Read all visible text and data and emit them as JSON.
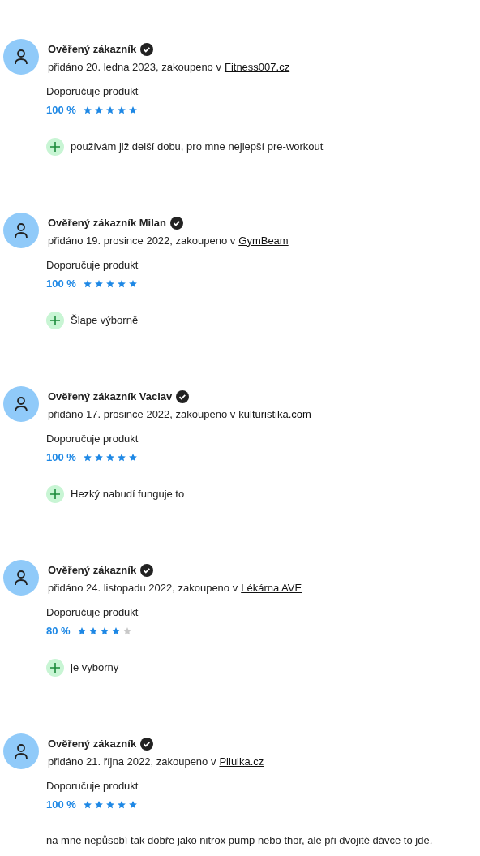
{
  "reviews": [
    {
      "author": "Ověřený zákazník",
      "verified": true,
      "date": "přidáno 20. ledna 2023, zakoupeno v",
      "shop": "Fitness007.cz",
      "recommend": "Doporučuje produkt",
      "percent": "100 %",
      "stars": 5,
      "comments": [
        {
          "kind": "pro",
          "text": "používám již delší dobu, pro mne nejlepší pre-workout"
        }
      ]
    },
    {
      "author": "Ověřený zákazník Milan",
      "verified": true,
      "date": "přidáno 19. prosince 2022, zakoupeno v",
      "shop": "GymBeam",
      "recommend": "Doporučuje produkt",
      "percent": "100 %",
      "stars": 5,
      "comments": [
        {
          "kind": "pro",
          "text": "Šlape výborně"
        }
      ]
    },
    {
      "author": "Ověřený zákazník Vaclav",
      "verified": true,
      "date": "přidáno 17. prosince 2022, zakoupeno v",
      "shop": "kulturistika.com",
      "recommend": "Doporučuje produkt",
      "percent": "100 %",
      "stars": 5,
      "comments": [
        {
          "kind": "pro",
          "text": "Hezký nabudí funguje to"
        }
      ]
    },
    {
      "author": "Ověřený zákazník",
      "verified": true,
      "date": "přidáno 24. listopadu 2022, zakoupeno v",
      "shop": "Lékárna AVE",
      "recommend": "Doporučuje produkt",
      "percent": "80 %",
      "stars": 4,
      "comments": [
        {
          "kind": "pro",
          "text": "je vyborny"
        }
      ]
    },
    {
      "author": "Ověřený zákazník",
      "verified": true,
      "date": "přidáno 21. října 2022, zakoupeno v",
      "shop": "Pilulka.cz",
      "recommend": "Doporučuje produkt",
      "percent": "100 %",
      "stars": 5,
      "comments": [
        {
          "kind": "text",
          "text": "na mne nepůsobí tak dobře jako nitrox pump nebo thor, ale při dvojité dávce to jde."
        }
      ]
    }
  ]
}
